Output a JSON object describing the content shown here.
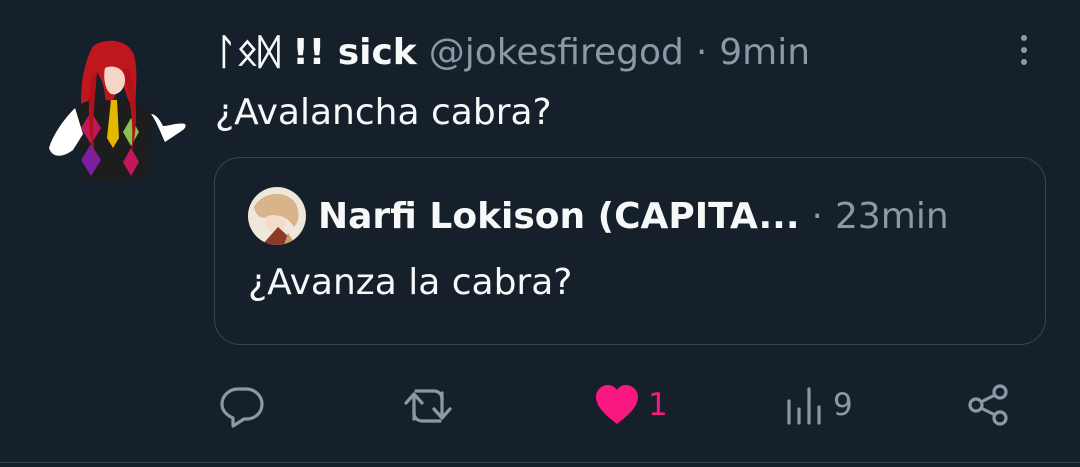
{
  "tweet": {
    "author_name": "ᛚᛟᛞ !! sick",
    "handle": "@jokesfiregod",
    "separator": "·",
    "time": "9min",
    "text": "¿Avalancha cabra?",
    "avatar_icon": "anime-avatar-red-hair",
    "more_icon": "more-vertical-icon"
  },
  "quoted": {
    "author_name": "Narfi Lokison (CAPITA...",
    "separator": "·",
    "time": "23min",
    "text": "¿Avanza la cabra?",
    "avatar_icon": "anime-avatar-small"
  },
  "actions": {
    "reply": {
      "icon": "reply-icon"
    },
    "retweet": {
      "icon": "retweet-icon"
    },
    "like": {
      "icon": "heart-filled-icon",
      "count": "1",
      "color": "#f91880"
    },
    "views": {
      "icon": "views-icon",
      "count": "9"
    },
    "share": {
      "icon": "share-icon"
    }
  },
  "colors": {
    "background": "#15202b",
    "text": "#f7f9f9",
    "muted": "#8b98a5",
    "border": "#38444d",
    "like": "#f91880"
  }
}
